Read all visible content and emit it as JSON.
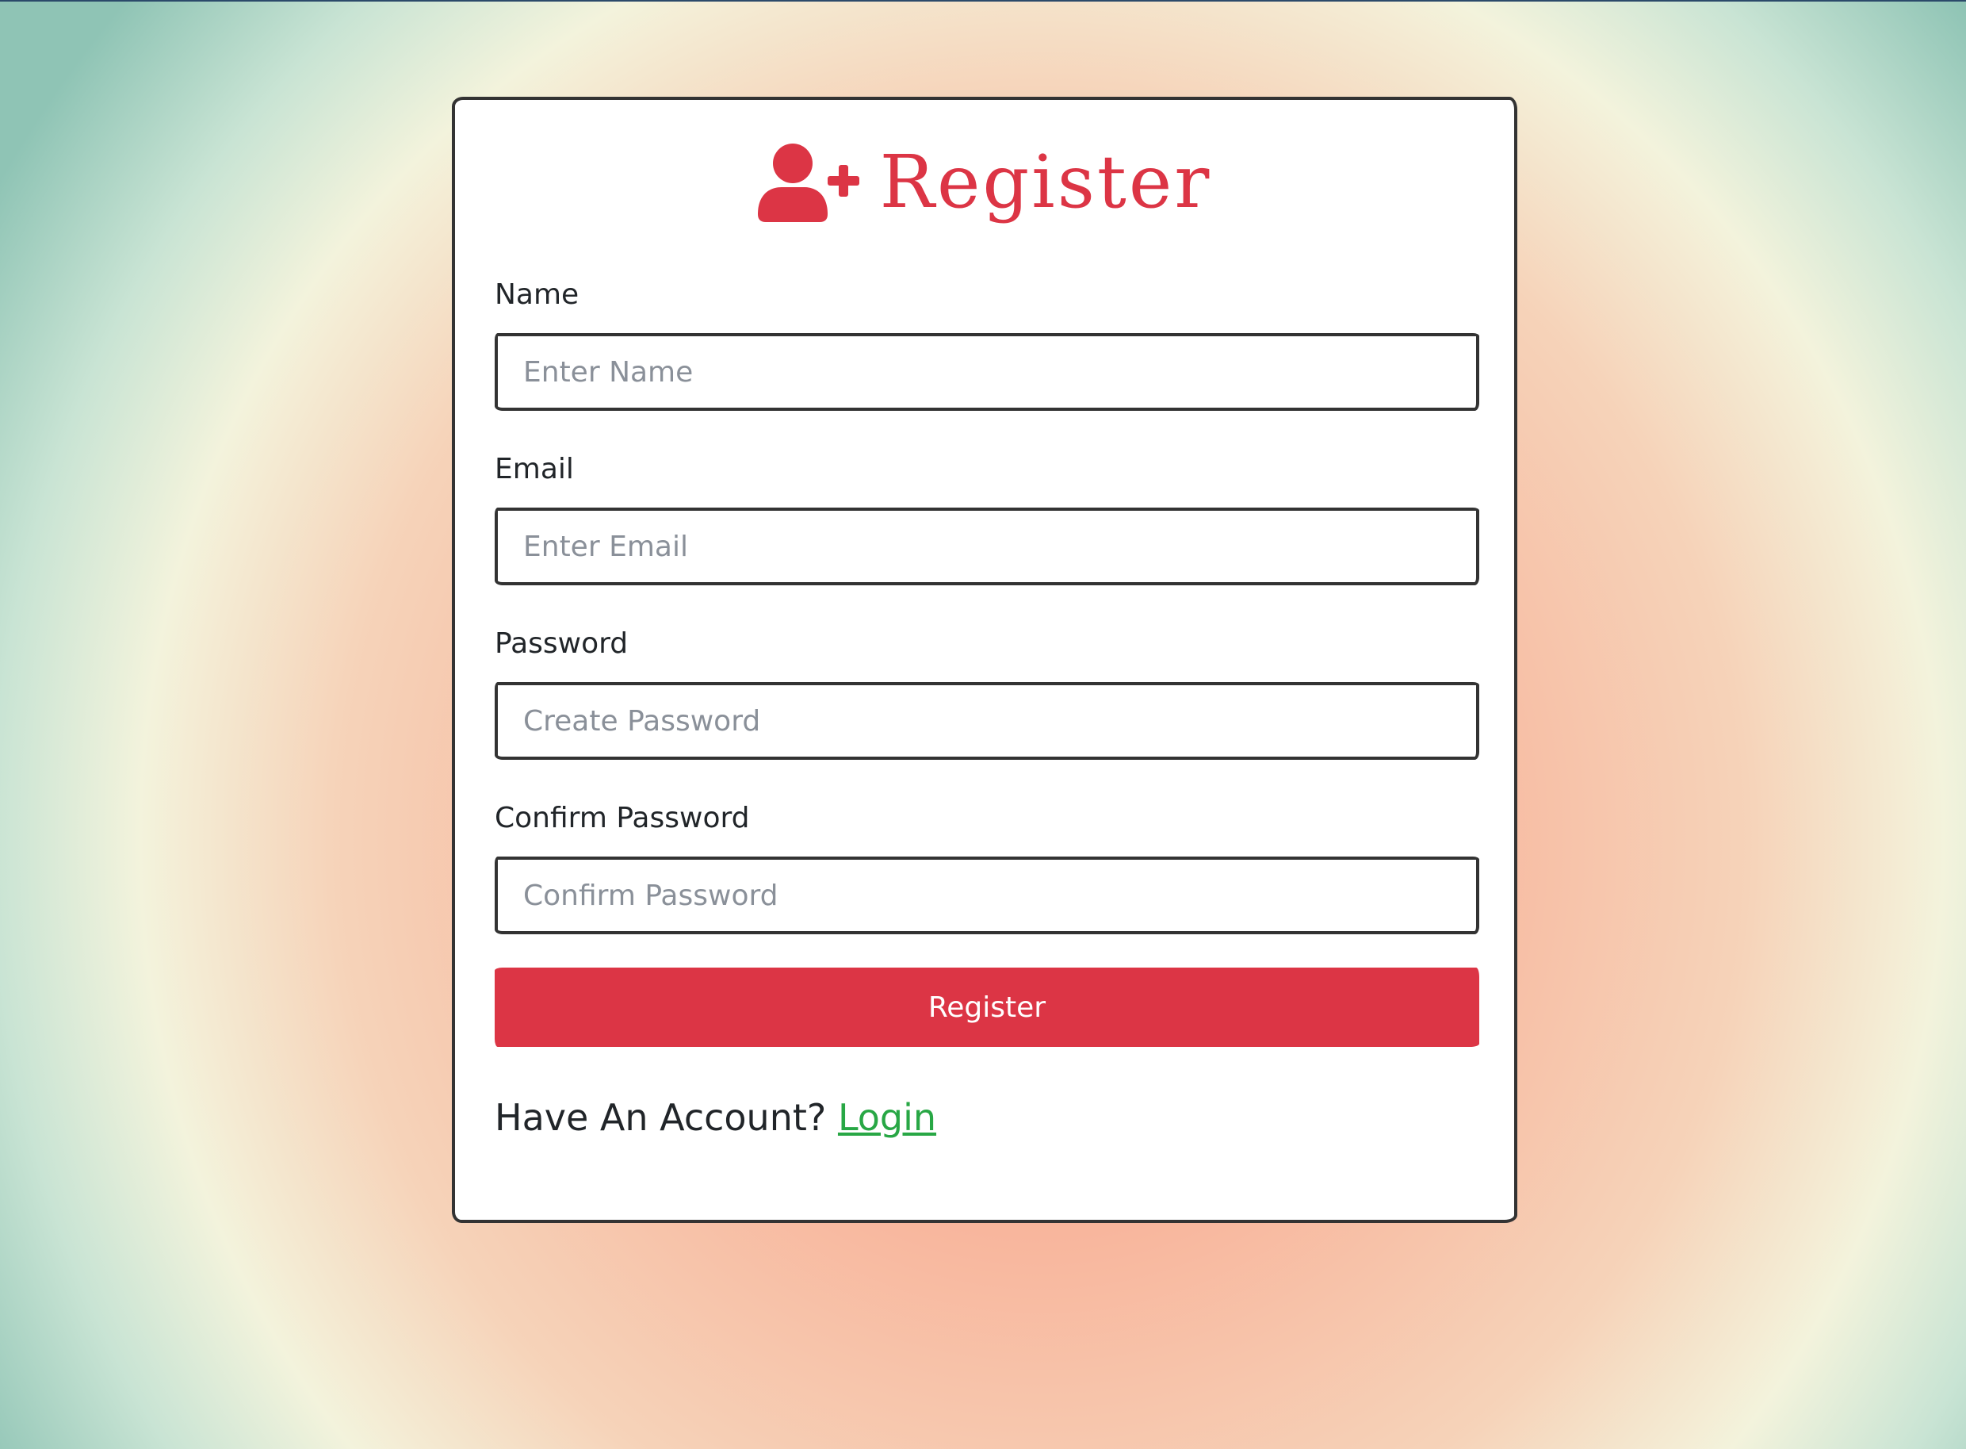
{
  "form": {
    "title": "Register",
    "title_icon": "user-plus-icon",
    "fields": [
      {
        "label": "Name",
        "placeholder": "Enter Name",
        "value": ""
      },
      {
        "label": "Email",
        "placeholder": "Enter Email",
        "value": ""
      },
      {
        "label": "Password",
        "placeholder": "Create Password",
        "value": ""
      },
      {
        "label": "Confirm Password",
        "placeholder": "Confirm Password",
        "value": ""
      }
    ],
    "submit_label": "Register",
    "footer_text": "Have An Account?",
    "login_link": "Login"
  },
  "colors": {
    "accent": "#dc3545",
    "link": "#28a745",
    "border": "#333333",
    "text": "#212529",
    "placeholder": "#8a9099"
  }
}
